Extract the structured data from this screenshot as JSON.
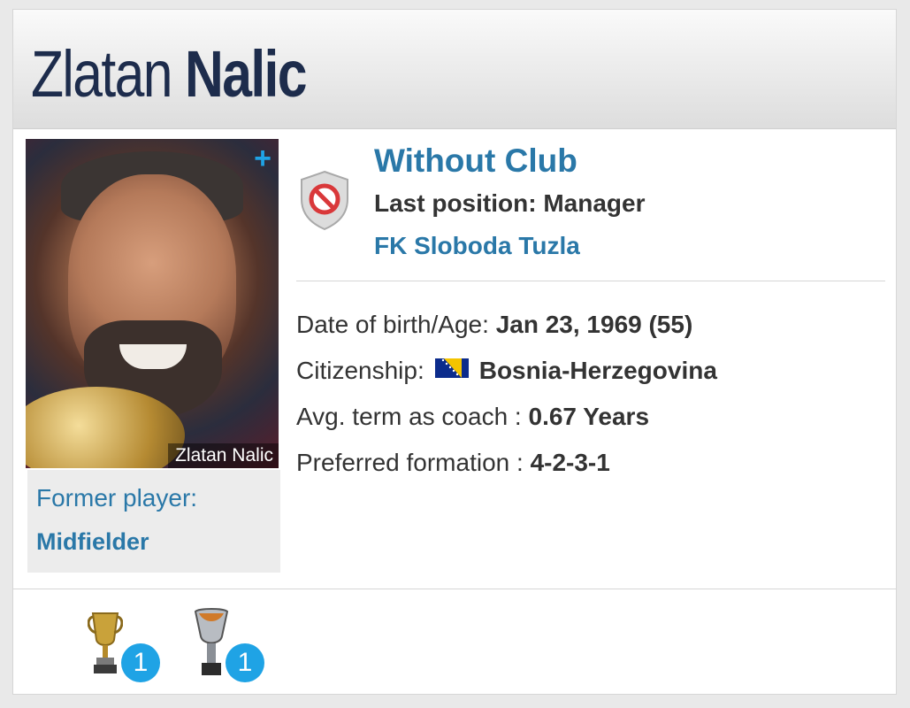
{
  "profile": {
    "first_name": "Zlatan",
    "last_name": "Nalic",
    "photo_caption": "Zlatan Nalic",
    "photo_expand": "+"
  },
  "former_player": {
    "label": "Former player:",
    "position": "Midfielder"
  },
  "club": {
    "status": "Without Club",
    "last_position_label": "Last position:",
    "last_position_value": "Manager",
    "last_club": "FK Sloboda Tuzla",
    "badge_icon": "no-entry-shield-icon"
  },
  "facts": {
    "birth_label": "Date of birth/Age:",
    "birth_value": "Jan 23, 1969 (55)",
    "citizenship_label": "Citizenship:",
    "citizenship_value": "Bosnia-Herzegovina",
    "term_label": "Avg. term as coach :",
    "term_value": "0.67 Years",
    "formation_label": "Preferred formation :",
    "formation_value": "4-2-3-1"
  },
  "trophies": [
    {
      "icon": "gold-cup-icon",
      "count": "1"
    },
    {
      "icon": "silver-cup-icon",
      "count": "1"
    }
  ],
  "colors": {
    "accent": "#2a78a8",
    "badge_blue": "#1fa3e5",
    "title_navy": "#1d2c4c"
  }
}
